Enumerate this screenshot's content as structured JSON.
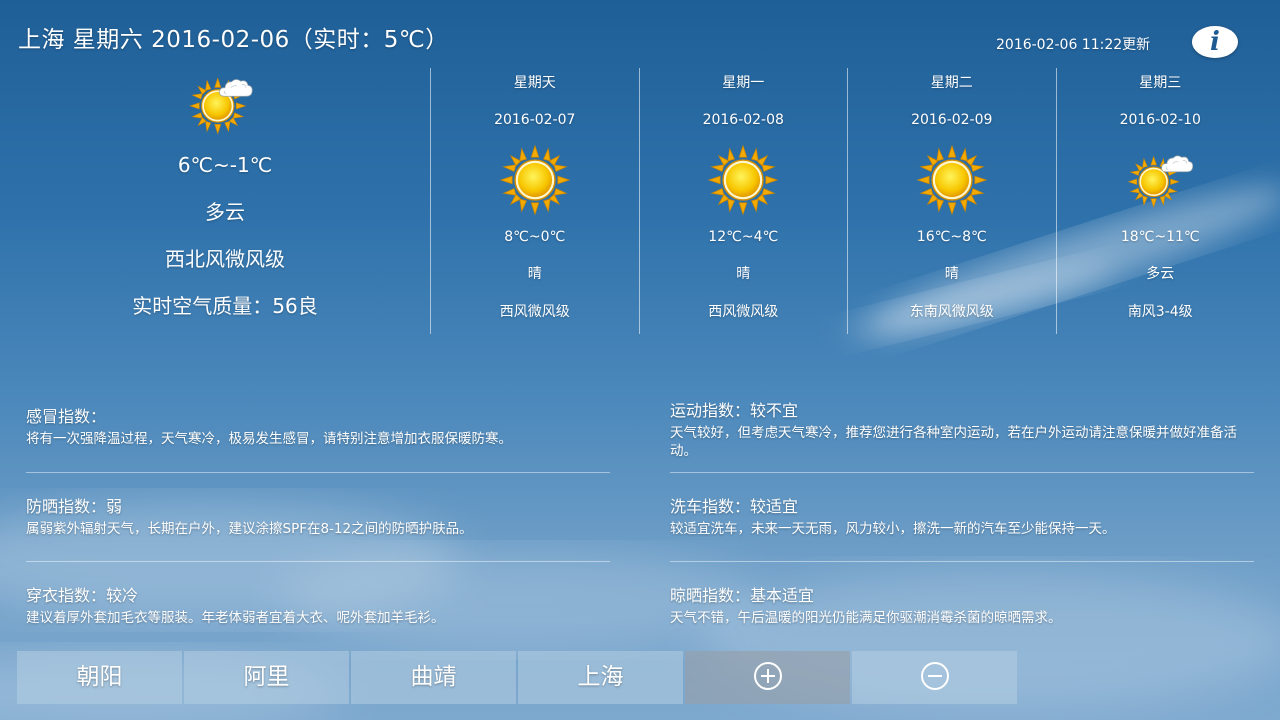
{
  "header": {
    "title": "上海 星期六 2016-02-06（实时：5℃）",
    "update_time": "2016-02-06 11:22更新",
    "info_icon": "info-icon"
  },
  "today": {
    "icon": "sunny-cloudy-icon",
    "temp_range": "6℃~-1℃",
    "condition": "多云",
    "wind": "西北风微风级",
    "air_quality": "实时空气质量：56良"
  },
  "forecast": [
    {
      "weekday": "星期天",
      "date": "2016-02-07",
      "icon": "sunny-icon",
      "temp": "8℃~0℃",
      "condition": "晴",
      "wind": "西风微风级"
    },
    {
      "weekday": "星期一",
      "date": "2016-02-08",
      "icon": "sunny-icon",
      "temp": "12℃~4℃",
      "condition": "晴",
      "wind": "西风微风级"
    },
    {
      "weekday": "星期二",
      "date": "2016-02-09",
      "icon": "sunny-icon",
      "temp": "16℃~8℃",
      "condition": "晴",
      "wind": "东南风微风级"
    },
    {
      "weekday": "星期三",
      "date": "2016-02-10",
      "icon": "sunny-cloudy-icon",
      "temp": "18℃~11℃",
      "condition": "多云",
      "wind": "南风3-4级"
    }
  ],
  "indices": {
    "cold": {
      "title": "感冒指数：",
      "desc": "将有一次强降温过程，天气寒冷，极易发生感冒，请特别注意增加衣服保暖防寒。"
    },
    "sport": {
      "title": "运动指数：较不宜",
      "desc": "天气较好，但考虑天气寒冷，推荐您进行各种室内运动，若在户外运动请注意保暖并做好准备活动。"
    },
    "sunscreen": {
      "title": "防晒指数：弱",
      "desc": "属弱紫外辐射天气，长期在户外，建议涂擦SPF在8-12之间的防晒护肤品。"
    },
    "carwash": {
      "title": "洗车指数：较适宜",
      "desc": "较适宜洗车，未来一天无雨，风力较小，擦洗一新的汽车至少能保持一天。"
    },
    "dressing": {
      "title": "穿衣指数：较冷",
      "desc": "建议着厚外套加毛衣等服装。年老体弱者宜着大衣、呢外套加羊毛衫。"
    },
    "drying": {
      "title": "晾晒指数：基本适宜",
      "desc": "天气不错，午后温暖的阳光仍能满足你驱潮消霉杀菌的晾晒需求。"
    }
  },
  "cities": [
    "朝阳",
    "阿里",
    "曲靖",
    "上海"
  ],
  "actions": {
    "add_icon": "plus-circle-icon",
    "remove_icon": "minus-circle-icon"
  },
  "colors": {
    "sky_top": "#1f5f97",
    "sky_bottom": "#7ea9cf",
    "sun": "#f7c600",
    "info_icon_text": "#1e5b93"
  }
}
